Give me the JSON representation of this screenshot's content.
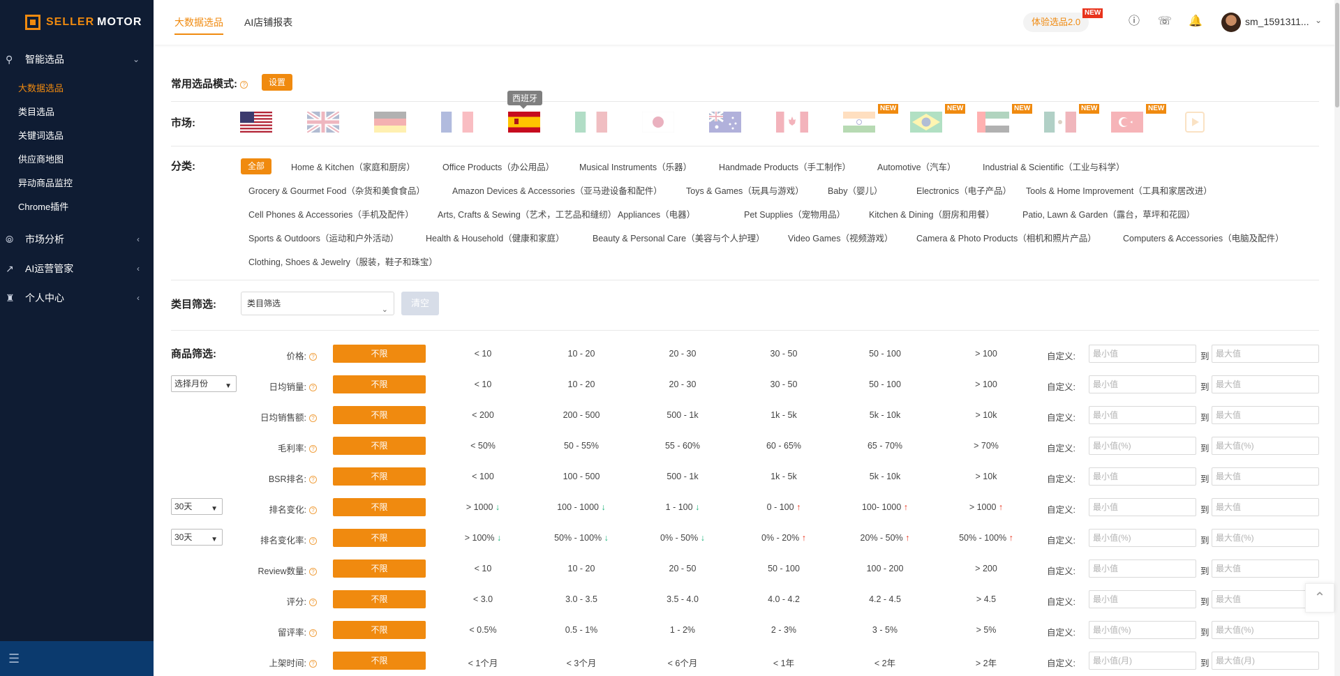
{
  "app": {
    "logo_text_a": "SELLER",
    "logo_text_b": "MOTOR"
  },
  "sidebar": {
    "groups": [
      {
        "label": "智能选品",
        "icon": "search-product-icon"
      },
      {
        "label": "市场分析",
        "icon": "compass-icon"
      },
      {
        "label": "AI运营管家",
        "icon": "trend-icon"
      },
      {
        "label": "个人中心",
        "icon": "user-hat-icon"
      }
    ],
    "subitems": [
      "大数据选品",
      "类目选品",
      "关键词选品",
      "供应商地图",
      "异动商品监控",
      "Chrome插件"
    ],
    "active_subitem": "大数据选品"
  },
  "header": {
    "tabs": [
      "大数据选品",
      "AI店铺报表"
    ],
    "trial_label": "体验选品2.0",
    "new_badge": "NEW",
    "username": "sm_1591311..."
  },
  "preset": {
    "label": "常用选品模式:",
    "button": "设置"
  },
  "market": {
    "label": "市场:",
    "tooltip": "西班牙",
    "flags": [
      "us-flag",
      "uk-flag",
      "de-flag",
      "fr-flag",
      "es-flag",
      "it-flag",
      "jp-flag",
      "au-flag",
      "ca-flag",
      "in-flag",
      "br-flag",
      "ae-flag",
      "mx-flag",
      "tr-flag",
      "video-icon"
    ],
    "new_badge": "NEW"
  },
  "category": {
    "label": "分类:",
    "all": "全部",
    "rows": [
      [
        "Home & Kitchen（家庭和厨房）",
        "Office Products（办公用品）",
        "Musical Instruments（乐器）",
        "Handmade Products（手工制作）",
        "Automotive（汽车）",
        "Industrial & Scientific（工业与科学）"
      ],
      [
        "Grocery & Gourmet Food（杂货和美食食品）",
        "Amazon Devices & Accessories（亚马逊设备和配件）",
        "Toys & Games（玩具与游戏）",
        "Baby（婴儿）",
        "Electronics（电子产品）",
        "Tools & Home Improvement（工具和家居改进）"
      ],
      [
        "Cell Phones & Accessories（手机及配件）",
        "Arts, Crafts & Sewing（艺术，工艺品和缝纫）",
        "Appliances（电器）",
        "Pet Supplies（宠物用品）",
        "Kitchen & Dining（厨房和用餐）",
        "Patio, Lawn & Garden（露台，草坪和花园）"
      ],
      [
        "Sports & Outdoors（运动和户外活动）",
        "Health & Household（健康和家庭）",
        "Beauty & Personal Care（美容与个人护理）",
        "Video Games（视频游戏）",
        "Camera & Photo Products（相机和照片产品）",
        "Computers & Accessories（电脑及配件）"
      ],
      [
        "Clothing, Shoes & Jewelry（服装，鞋子和珠宝）"
      ]
    ]
  },
  "category_filter": {
    "label": "类目筛选:",
    "placeholder": "类目筛选",
    "clear": "清空"
  },
  "product_filter": {
    "label": "商品筛选:",
    "month_select": "选择月份",
    "days_select": "30天",
    "no_limit": "不限",
    "custom": "自定义:",
    "to": "到",
    "rows": [
      {
        "label": "价格:",
        "opts": [
          "< 10",
          "10 - 20",
          "20 - 30",
          "30 - 50",
          "50 - 100",
          "> 100"
        ],
        "min": "最小值",
        "max": "最大值"
      },
      {
        "label": "日均销量:",
        "opts": [
          "< 10",
          "10 - 20",
          "20 - 30",
          "30 - 50",
          "50 - 100",
          "> 100"
        ],
        "min": "最小值",
        "max": "最大值"
      },
      {
        "label": "日均销售额:",
        "opts": [
          "< 200",
          "200 - 500",
          "500 - 1k",
          "1k - 5k",
          "5k - 10k",
          "> 10k"
        ],
        "min": "最小值",
        "max": "最大值"
      },
      {
        "label": "毛利率:",
        "opts": [
          "< 50%",
          "50 - 55%",
          "55 - 60%",
          "60 - 65%",
          "65 - 70%",
          "> 70%"
        ],
        "min": "最小值(%)",
        "max": "最大值(%)"
      },
      {
        "label": "BSR排名:",
        "opts": [
          "< 100",
          "100 - 500",
          "500 - 1k",
          "1k - 5k",
          "5k - 10k",
          "> 10k"
        ],
        "min": "最小值",
        "max": "最大值"
      },
      {
        "label": "排名变化:",
        "opts": [
          "> 1000",
          "100 - 1000",
          "1 - 100",
          "0 - 100",
          "100- 1000",
          "> 1000"
        ],
        "min": "最小值",
        "max": "最大值"
      },
      {
        "label": "排名变化率:",
        "opts": [
          "> 100%",
          "50% - 100%",
          "0% - 50%",
          "0% - 20%",
          "20% - 50%",
          "50% - 100%"
        ],
        "min": "最小值(%)",
        "max": "最大值(%)"
      },
      {
        "label": "Review数量:",
        "opts": [
          "< 10",
          "10 - 20",
          "20 - 50",
          "50 - 100",
          "100 - 200",
          "> 200"
        ],
        "min": "最小值",
        "max": "最大值"
      },
      {
        "label": "评分:",
        "opts": [
          "< 3.0",
          "3.0 - 3.5",
          "3.5 - 4.0",
          "4.0 - 4.2",
          "4.2 - 4.5",
          "> 4.5"
        ],
        "min": "最小值",
        "max": "最大值"
      },
      {
        "label": "留评率:",
        "opts": [
          "< 0.5%",
          "0.5 - 1%",
          "1 - 2%",
          "2 - 3%",
          "3 - 5%",
          "> 5%"
        ],
        "min": "最小值(%)",
        "max": "最大值(%)"
      },
      {
        "label": "上架时间:",
        "opts": [
          "< 1个月",
          "< 3个月",
          "< 6个月",
          "< 1年",
          "< 2年",
          "> 2年"
        ],
        "min": "最小值(月)",
        "max": "最大值(月)"
      }
    ]
  },
  "colors": {
    "accent": "#f08a0f",
    "sidebar_bg": "#0f1c33",
    "down": "#1cb37a",
    "up": "#e8331c"
  }
}
